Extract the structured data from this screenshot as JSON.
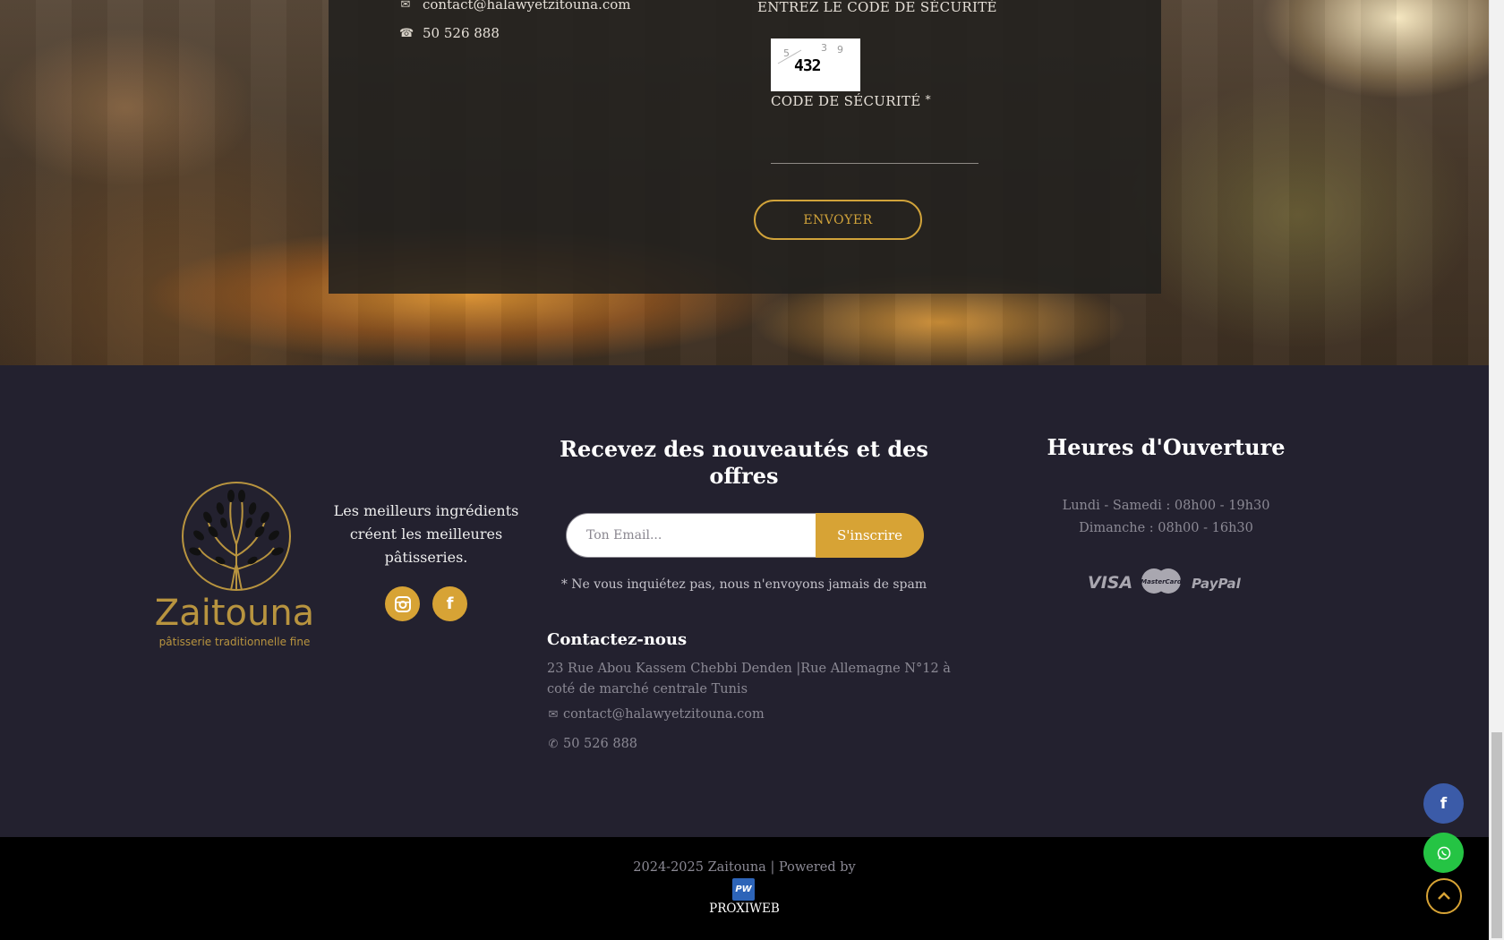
{
  "contact_form": {
    "email": "contact@halawyetzitouna.com",
    "phone": "50 526 888",
    "captcha_heading": "ENTREZ LE CODE DE SÉCURITÉ",
    "captcha_code": "432",
    "code_label": "CODE DE SÉCURITÉ",
    "required_mark": "*",
    "send_label": "ENVOYER"
  },
  "footer": {
    "brand_name": "Zaitouna",
    "brand_subtitle": "pâtisserie traditionnelle fine",
    "tagline": "Les meilleurs ingrédients créent les meilleures pâtisseries.",
    "newsletter": {
      "title": "Recevez des nouveautés et des offres",
      "email_placeholder": "Ton Email...",
      "subscribe_label": "S'inscrire",
      "note": "* Ne vous inquiétez pas, nous n'envoyons jamais de spam"
    },
    "contact": {
      "title": "Contactez-nous",
      "address": "23 Rue Abou Kassem Chebbi Denden |Rue Allemagne N°12 à coté de marché centrale Tunis",
      "email": "contact@halawyetzitouna.com",
      "phone": "50 526 888"
    },
    "hours": {
      "title": "Heures d'Ouverture",
      "weekdays": "Lundi - Samedi : 08h00 - 19h30",
      "sunday": "Dimanche : 08h00 - 16h30"
    },
    "payments": {
      "visa": "VISA",
      "mastercard": "MasterCard",
      "paypal": "PayPal"
    }
  },
  "copyright": {
    "text": "2024-2025 Zaitouna | Powered by",
    "logo_text": "PW",
    "company": "PROXIWEB"
  },
  "colors": {
    "accent": "#d7a335",
    "footer_bg": "#23212f",
    "facebook": "#3b5ba8",
    "whatsapp": "#25c444"
  }
}
